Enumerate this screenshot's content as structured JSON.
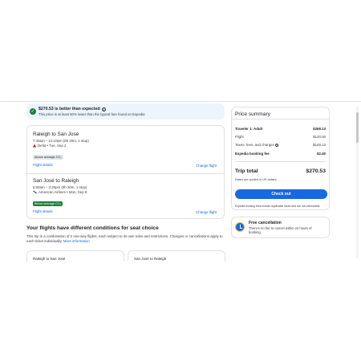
{
  "banner": {
    "headline": "$270.53 is better than expected",
    "sub": "This price is at least 50% lower than the typical fare found on Expedia"
  },
  "flights": [
    {
      "route": "Raleigh to San José",
      "times": "7:45am – 12:10pm (6h 25m, 1 stop)",
      "airline": "Delta • Tue, Sep 2",
      "badge": "Above average CO₂",
      "details_link": "Flight details",
      "change_link": "Change flight"
    },
    {
      "route": "San José to Raleigh",
      "times": "6:00am – 3:20pm (9h 20m, 1 stop)",
      "airline": "American Airlines • Mon, Sep 8",
      "badge": "Below average CO₂",
      "details_link": "Flight details",
      "change_link": "Change flight"
    }
  ],
  "conditions": {
    "title": "Your flights have different conditions for seat choice",
    "text": "This trip is a combination of 2 one-way flights, each subject to its own rules and restrictions. Changes or cancellations apply to each ticket individually.",
    "more_link": "More information",
    "cards": [
      "Raleigh to San José",
      "San José to Raleigh"
    ]
  },
  "summary": {
    "title": "Price summary",
    "rows": [
      {
        "label": "Traveler 1: Adult",
        "value": "$268.13"
      },
      {
        "label": "Flight",
        "value": "$120.00"
      },
      {
        "label": "Taxes, fees, and charges",
        "value": "$148.13"
      },
      {
        "label": "Expedia booking fee",
        "value": "$2.40"
      }
    ],
    "total_label": "Trip total",
    "total_value": "$270.53",
    "rates_note": "Rates are quoted in US dollars",
    "checkout_label": "Check out",
    "fees_note": "Expedia booking fees include applicable taxes and are non-refundable."
  },
  "cancellation": {
    "title": "Free cancellation",
    "text": "There's no fee to cancel within 24 hours of booking."
  },
  "colors": {
    "accent": "#1668e3",
    "success": "#1c7e3c",
    "banner_bg": "#ecf4fd"
  }
}
